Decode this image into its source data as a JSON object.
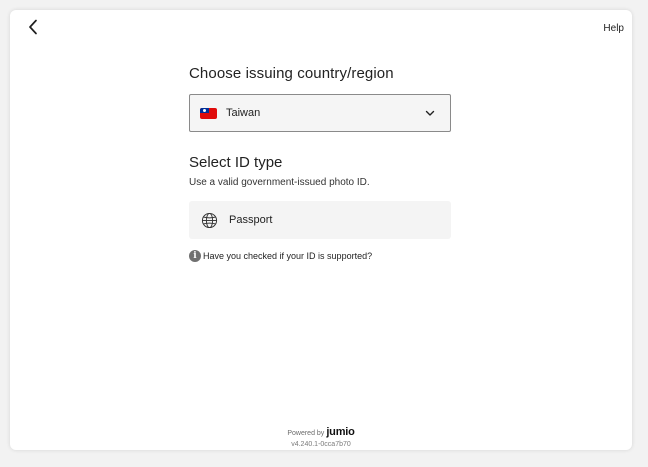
{
  "header": {
    "back_icon": "chevron-left-icon",
    "help_label": "Help"
  },
  "country": {
    "heading": "Choose issuing country/region",
    "selected": "Taiwan",
    "flag_icon": "taiwan-flag-icon",
    "dropdown_icon": "chevron-down-icon"
  },
  "id_type": {
    "heading": "Select ID type",
    "subtitle": "Use a valid government-issued photo ID.",
    "options": [
      {
        "label": "Passport",
        "icon": "globe-icon"
      }
    ]
  },
  "support": {
    "icon": "info-icon",
    "info_glyph": "i",
    "text": "Have you checked if your ID is supported?"
  },
  "footer": {
    "powered_by": "Powered by",
    "brand": "jumio",
    "version": "v4.240.1-0cca7b70"
  },
  "colors": {
    "background": "#f2f2f2",
    "card": "#ffffff",
    "select_border": "#8a8a8a",
    "option_bg": "#f4f4f4",
    "flag_red": "#e00b0b",
    "flag_blue": "#00309a"
  }
}
